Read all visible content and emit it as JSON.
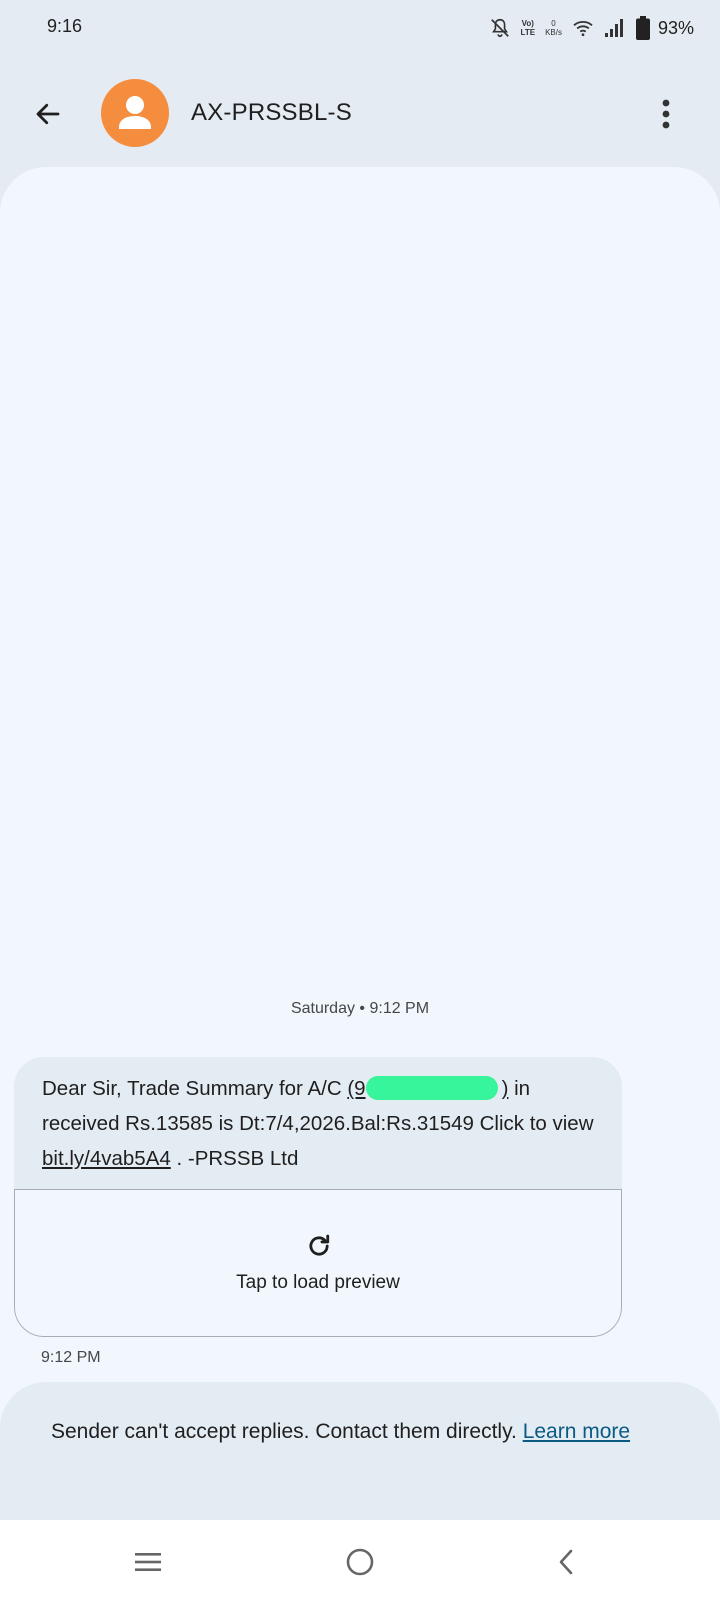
{
  "status_bar": {
    "time": "9:16",
    "network_top": "Vo)",
    "network_bottom": "LTE",
    "speed_value": "0",
    "speed_unit": "KB/s",
    "battery": "93%"
  },
  "header": {
    "sender": "AX-PRSSBL-S",
    "avatar_color": "#f58d3f"
  },
  "conversation": {
    "date_stamp": "Saturday • 9:12 PM",
    "message": {
      "part1": "Dear Sir, Trade Summary for A/C ",
      "acct_open": "(9",
      "acct_close": ")",
      "part2": " in received Rs.13585 is Dt:7/4,2026.Bal:Rs.31549 Click to view ",
      "link": "bit.ly/4vab5A4",
      "part3": " . -PRSSB Ltd",
      "redaction_color": "#36f59b"
    },
    "preview_label": "Tap to load preview",
    "message_time": "9:12 PM"
  },
  "reply_banner": {
    "text": "Sender can't accept replies. Contact them directly. ",
    "link": "Learn more"
  }
}
